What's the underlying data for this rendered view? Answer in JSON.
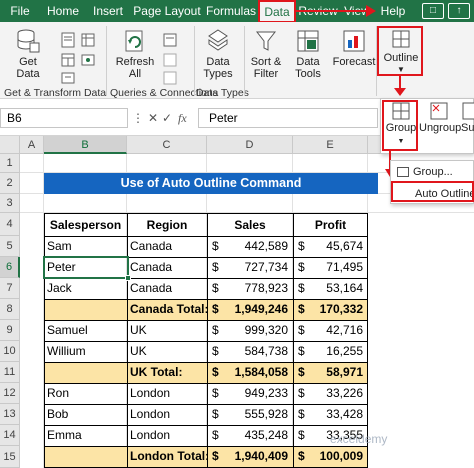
{
  "tabs": [
    {
      "label": "File"
    },
    {
      "label": "Home"
    },
    {
      "label": "Insert"
    },
    {
      "label": "Page Layout"
    },
    {
      "label": "Formulas"
    },
    {
      "label": "Data"
    },
    {
      "label": "Review"
    },
    {
      "label": "View"
    },
    {
      "label": "Help"
    }
  ],
  "ribbon": {
    "get_data": "Get Data",
    "refresh_all": "Refresh All",
    "data_types": "Data Types",
    "sort_filter": "Sort & Filter",
    "data_tools": "Data Tools",
    "forecast": "Forecast",
    "outline": "Outline",
    "group_get_transform": "Get & Transform Data",
    "group_queries": "Queries & Connections",
    "group_data_types": "Data Types"
  },
  "outline_menu": {
    "group": "Group",
    "ungroup": "Ungroup",
    "subtotal": "Sub",
    "group_item": "Group...",
    "auto_outline": "Auto Outline"
  },
  "formula_bar": {
    "name_box": "B6",
    "fx": "fx",
    "formula": "Peter"
  },
  "columns": [
    "A",
    "B",
    "C",
    "D",
    "E"
  ],
  "rows": [
    "1",
    "2",
    "3",
    "4",
    "5",
    "6",
    "7",
    "8",
    "9",
    "10",
    "11",
    "12",
    "13",
    "14",
    "15"
  ],
  "sheet": {
    "title": "Use of Auto Outline Command",
    "headers": [
      "Salesperson",
      "Region",
      "Sales",
      "Profit"
    ],
    "records": [
      {
        "sp": "Sam",
        "region": "Canada",
        "cur1": "$",
        "sales": "442,589",
        "cur2": "$",
        "profit": "45,674"
      },
      {
        "sp": "Peter",
        "region": "Canada",
        "cur1": "$",
        "sales": "727,734",
        "cur2": "$",
        "profit": "71,495"
      },
      {
        "sp": "Jack",
        "region": "Canada",
        "cur1": "$",
        "sales": "778,923",
        "cur2": "$",
        "profit": "53,164"
      },
      {
        "sp": "",
        "region": "Canada Total:",
        "cur1": "$",
        "sales": "1,949,246",
        "cur2": "$",
        "profit": "170,332"
      },
      {
        "sp": "Samuel",
        "region": "UK",
        "cur1": "$",
        "sales": "999,320",
        "cur2": "$",
        "profit": "42,716"
      },
      {
        "sp": "Willium",
        "region": "UK",
        "cur1": "$",
        "sales": "584,738",
        "cur2": "$",
        "profit": "16,255"
      },
      {
        "sp": "",
        "region": "UK Total:",
        "cur1": "$",
        "sales": "1,584,058",
        "cur2": "$",
        "profit": "58,971"
      },
      {
        "sp": "Ron",
        "region": "London",
        "cur1": "$",
        "sales": "949,233",
        "cur2": "$",
        "profit": "33,226"
      },
      {
        "sp": "Bob",
        "region": "London",
        "cur1": "$",
        "sales": "555,928",
        "cur2": "$",
        "profit": "33,428"
      },
      {
        "sp": "Emma",
        "region": "London",
        "cur1": "$",
        "sales": "435,248",
        "cur2": "$",
        "profit": "33,355"
      },
      {
        "sp": "",
        "region": "London Total:",
        "cur1": "$",
        "sales": "1,940,409",
        "cur2": "$",
        "profit": "100,009"
      }
    ]
  },
  "watermark": "exceldemy",
  "colors": {
    "excel_green": "#217346",
    "banner_blue": "#1565c0",
    "total_yellow": "#fce4a6",
    "highlight_red": "#e0161c"
  }
}
